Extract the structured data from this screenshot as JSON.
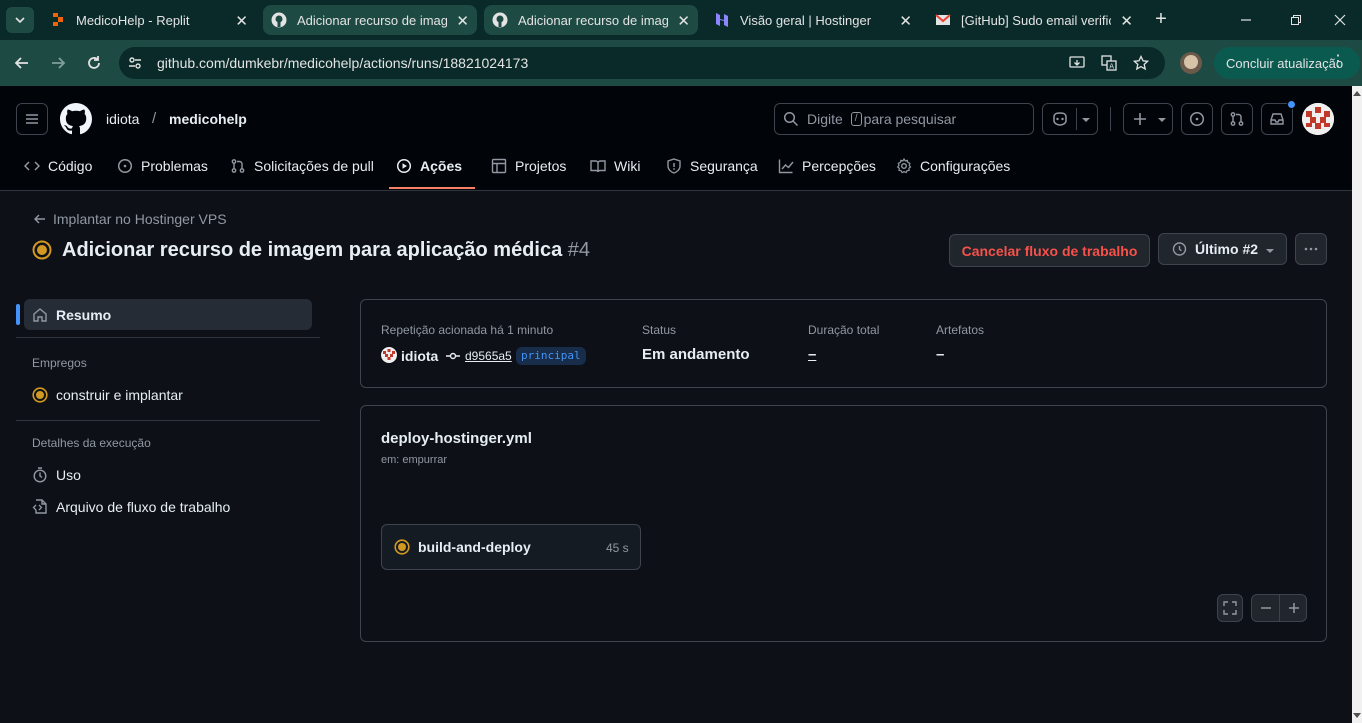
{
  "browser": {
    "tabs": [
      {
        "title": "MedicoHelp - Replit"
      },
      {
        "title": "Adicionar recurso de imagem"
      },
      {
        "title": "Adicionar recurso de imagem"
      },
      {
        "title": "Visão geral | Hostinger"
      },
      {
        "title": "[GitHub] Sudo email verification"
      }
    ],
    "url": "github.com/dumkebr/medicohelp/actions/runs/18821024173",
    "update_label": "Concluir atualização"
  },
  "header": {
    "owner": "idiota",
    "separator": "/",
    "repo": "medicohelp",
    "search_placeholder_pre": "Digite",
    "search_key": "/",
    "search_placeholder_post": "para pesquisar"
  },
  "repo_nav": [
    {
      "label": "Código",
      "icon": "code-icon"
    },
    {
      "label": "Problemas",
      "icon": "issue-icon"
    },
    {
      "label": "Solicitações de pull",
      "icon": "pull-request-icon"
    },
    {
      "label": "Ações",
      "icon": "play-icon",
      "selected": true
    },
    {
      "label": "Projetos",
      "icon": "table-icon"
    },
    {
      "label": "Wiki",
      "icon": "book-icon"
    },
    {
      "label": "Segurança",
      "icon": "shield-icon"
    },
    {
      "label": "Percepções",
      "icon": "graph-icon"
    },
    {
      "label": "Configurações",
      "icon": "gear-icon"
    }
  ],
  "run": {
    "back_link": "Implantar no Hostinger VPS",
    "title": "Adicionar recurso de imagem para aplicação médica",
    "number": "#4",
    "cancel_label": "Cancelar fluxo de trabalho",
    "attempt_label": "Último #2"
  },
  "sidebar": {
    "summary": "Resumo",
    "jobs_heading": "Empregos",
    "job": "construir e implantar",
    "details_heading": "Detalhes da execução",
    "usage": "Uso",
    "workflow_file": "Arquivo de fluxo de trabalho"
  },
  "summary": {
    "trigger_label": "Repetição acionada há 1 minuto",
    "actor": "idiota",
    "commit": "d9565a5",
    "branch": "principal",
    "status_label": "Status",
    "status_value": "Em andamento",
    "duration_label": "Duração total",
    "duration_value": "–",
    "artifacts_label": "Artefatos",
    "artifacts_value": "–"
  },
  "workflow": {
    "file": "deploy-hostinger.yml",
    "trigger": "em: empurrar",
    "job_name": "build-and-deploy",
    "job_time": "45 s"
  },
  "colors": {
    "in_progress": "#d29922",
    "danger": "#f85149",
    "accent_underline": "#f78166"
  }
}
